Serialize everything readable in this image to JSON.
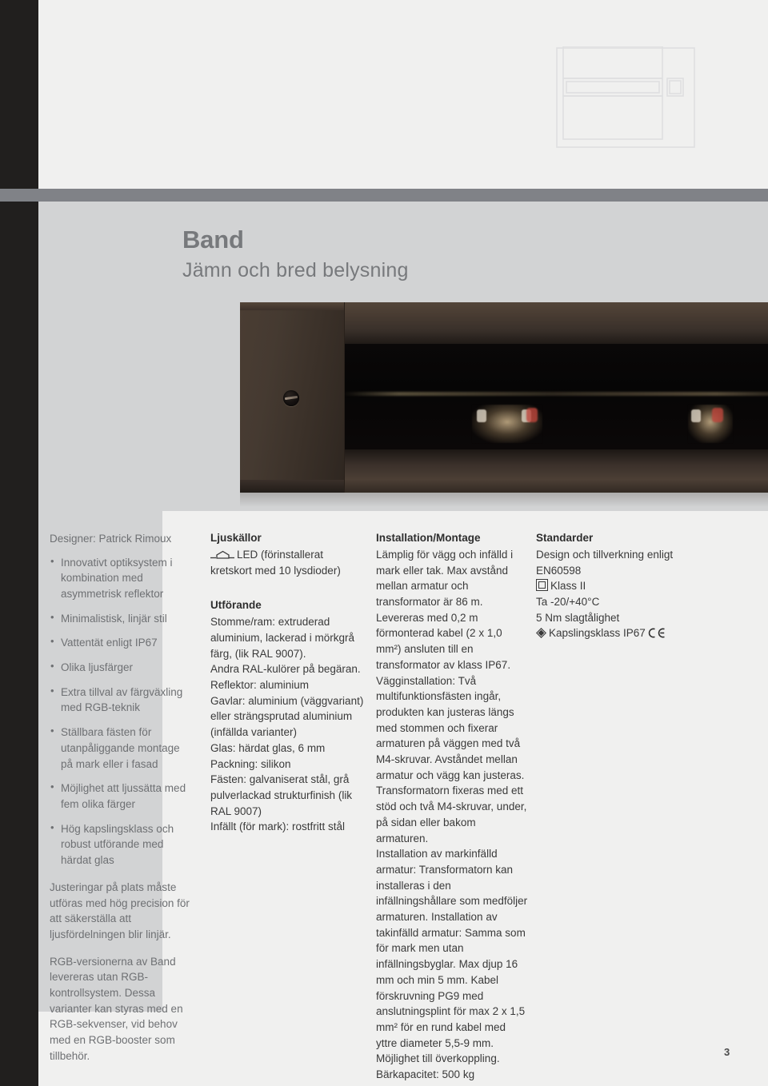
{
  "page": {
    "number": "3",
    "background_color": "#f0f0ef",
    "accent_dark": "#211f1e",
    "panel_gray": "#d2d3d4",
    "band_gray": "#808287"
  },
  "header": {
    "watermark_icon": "abstract-frame-outline"
  },
  "title": {
    "name": "Band",
    "subtitle": "Jämn och bred belysning"
  },
  "product_photo": {
    "alt": "Band linear luminaire, dark bronze housing with glass front",
    "screw_icon": "slotted-screw-icon"
  },
  "column_features": {
    "designer_label": "Designer: Patrick Rimoux",
    "bullets": [
      "Innovativt optiksystem i kombination med asymmetrisk reflektor",
      "Minimalistisk, linjär stil",
      "Vattentät enligt IP67",
      "Olika ljusfärger",
      "Extra tillval av färgväxling med RGB-teknik",
      "Ställbara fästen för utanpåliggande montage på mark eller i fasad",
      "Möjlighet att ljussätta med fem olika färger",
      "Hög kapslingsklass och robust utförande med härdat glas"
    ],
    "paragraphs": [
      "Justeringar på plats måste utföras med hög precision för att säkerställa att ljusfördelningen blir linjär.",
      "RGB-versionerna av Band levereras utan RGB-kontrollsystem. Dessa varianter kan styras med en RGB-sekvenser, vid behov med en RGB-booster som tillbehör."
    ]
  },
  "column_light_sources": {
    "heading": "Ljuskällor",
    "led_icon": "led-lamp-symbol-icon",
    "led_text": "LED (förinstallerat kretskort med 10 lysdioder)",
    "construction_heading": "Utförande",
    "construction_lines": [
      "Stomme/ram: extruderad aluminium, lackerad i mörkgrå färg, (lik RAL 9007).",
      "Andra RAL-kulörer på begäran.",
      "Reflektor: aluminium",
      "Gavlar: aluminium (väggvariant) eller strängsprutad aluminium (infällda varianter)",
      "Glas: härdat glas, 6 mm",
      "Packning: silikon",
      "Fästen: galvaniserat stål, grå pulverlackad strukturfinish (lik RAL 9007)",
      "Infällt (för mark): rostfritt stål"
    ]
  },
  "column_installation": {
    "heading": "Installation/Montage",
    "paragraphs": [
      "Lämplig för vägg och infälld i mark eller tak. Max avstånd mellan armatur och transformator är 86 m. Levereras med 0,2 m förmonterad kabel (2 x 1,0 mm²) ansluten till en transformator av klass IP67.",
      "Vägginstallation: Två multifunktionsfästen ingår, produkten kan justeras längs med stommen och fixerar armaturen på väggen med två M4-skruvar. Avståndet mellan armatur och vägg kan justeras. Transformatorn fixeras med ett stöd och två M4-skruvar, under, på sidan eller bakom armaturen.",
      "Installation av markinfälld armatur: Transformatorn kan installeras i den infällningshållare som medföljer armaturen. Installation av takinfälld armatur: Samma som för mark men utan infällningsbyglar. Max djup 16 mm och min 5 mm. Kabel förskruvning PG9 med anslutningsplint för max 2 x 1,5 mm² för en rund kabel med yttre diameter 5,5-9 mm. Möjlighet till överkoppling. Bärkapacitet: 500 kg"
    ]
  },
  "column_standards": {
    "heading": "Standarder",
    "lines": [
      "Design och tillverkning enligt",
      "EN60598"
    ],
    "class_ii_icon": "class-ii-double-square-icon",
    "class_ii_label": "Klass II",
    "temperature": "Ta -20/+40°C",
    "impact": "5 Nm slagtålighet",
    "ingress_icon": "impact-diamond-icon",
    "ingress_label": "Kapslingsklass IP67",
    "ce_icon": "ce-mark-icon"
  }
}
